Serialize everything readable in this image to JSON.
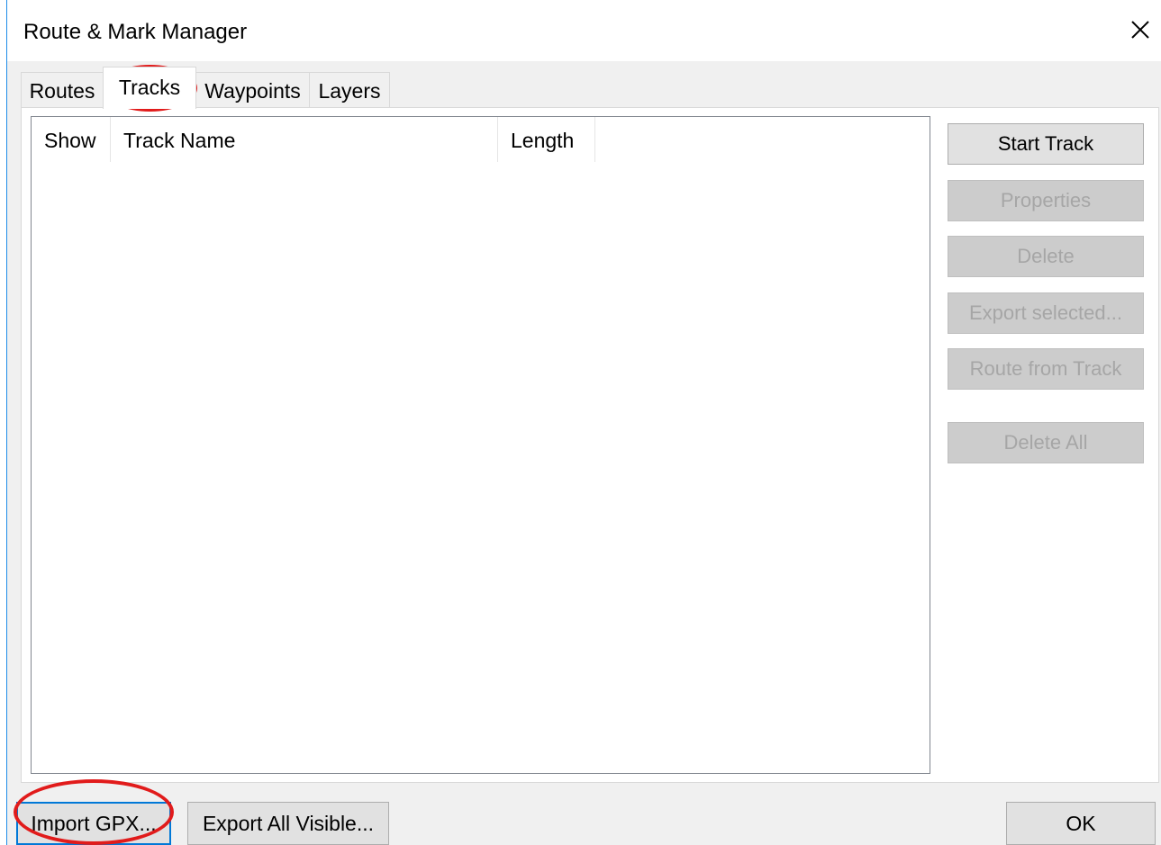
{
  "window": {
    "title": "Route & Mark Manager",
    "close_symbol": "✕"
  },
  "tabs": [
    {
      "label": "Routes",
      "active": false
    },
    {
      "label": "Tracks",
      "active": true
    },
    {
      "label": "Waypoints",
      "active": false
    },
    {
      "label": "Layers",
      "active": false
    }
  ],
  "table": {
    "columns": [
      "Show",
      "Track Name",
      "Length"
    ],
    "rows": []
  },
  "side_buttons": {
    "start_track": "Start Track",
    "properties": "Properties",
    "delete": "Delete",
    "export_selected": "Export selected...",
    "route_from_track": "Route from Track",
    "delete_all": "Delete All"
  },
  "bottom_buttons": {
    "import_gpx": "Import GPX...",
    "export_all_visible": "Export All Visible...",
    "ok": "OK"
  },
  "colors": {
    "annotation": "#e11b1b",
    "focus": "#0078d7"
  },
  "icons": {
    "close": "close-icon"
  }
}
